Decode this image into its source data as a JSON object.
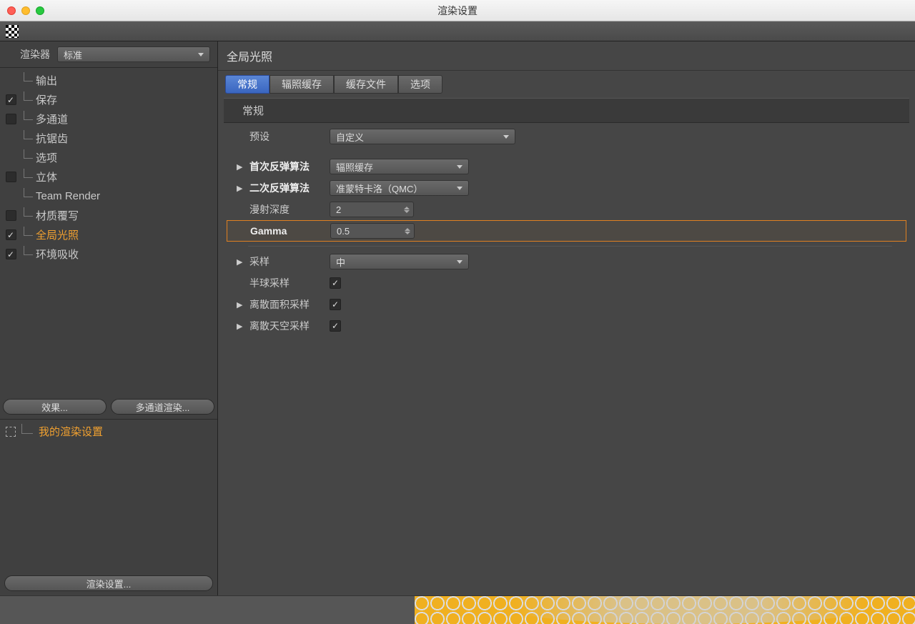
{
  "window": {
    "title": "渲染设置"
  },
  "renderer": {
    "label": "渲染器",
    "value": "标准"
  },
  "sidebar": {
    "items": [
      {
        "label": "输出",
        "checkbox": null
      },
      {
        "label": "保存",
        "checkbox": true
      },
      {
        "label": "多通道",
        "checkbox": false
      },
      {
        "label": "抗锯齿",
        "checkbox": null
      },
      {
        "label": "选项",
        "checkbox": null
      },
      {
        "label": "立体",
        "checkbox": false
      },
      {
        "label": "Team Render",
        "checkbox": null
      },
      {
        "label": "材质覆写",
        "checkbox": false
      },
      {
        "label": "全局光照",
        "checkbox": true,
        "active": true
      },
      {
        "label": "环境吸收",
        "checkbox": true
      }
    ],
    "effects_btn": "效果...",
    "multipass_btn": "多通道渲染...",
    "my_settings": "我的渲染设置",
    "footer_btn": "渲染设置..."
  },
  "main": {
    "title": "全局光照",
    "tabs": [
      "常规",
      "辐照缓存",
      "缓存文件",
      "选项"
    ],
    "active_tab": 0,
    "section_header": "常规",
    "preset": {
      "label": "预设",
      "value": "自定义"
    },
    "primary": {
      "label": "首次反弹算法",
      "value": "辐照缓存"
    },
    "secondary": {
      "label": "二次反弹算法",
      "value": "准蒙特卡洛（QMC）"
    },
    "diffuse_depth": {
      "label": "漫射深度",
      "value": "2"
    },
    "gamma": {
      "label": "Gamma",
      "value": "0.5"
    },
    "sampling": {
      "label": "采样",
      "value": "中"
    },
    "hemisphere": {
      "label": "半球采样",
      "checked": true
    },
    "discrete_area": {
      "label": "离散面积采样",
      "checked": true
    },
    "discrete_sky": {
      "label": "离散天空采样",
      "checked": true
    }
  }
}
